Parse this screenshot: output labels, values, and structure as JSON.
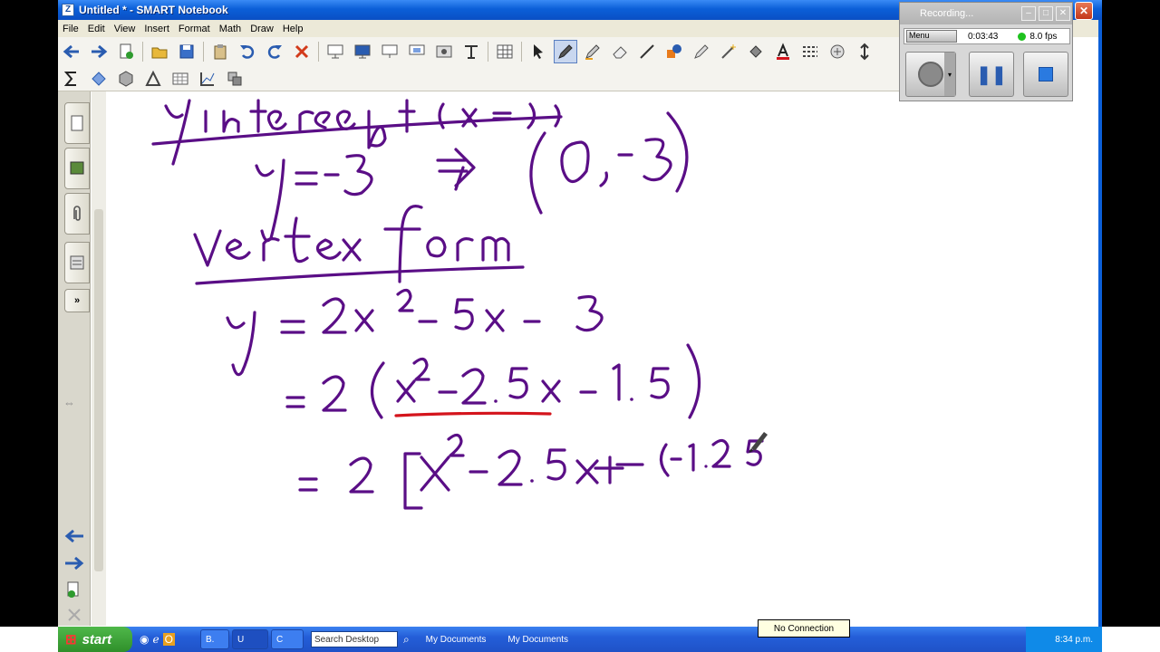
{
  "window": {
    "title": "Untitled * - SMART Notebook"
  },
  "menu": [
    "File",
    "Edit",
    "View",
    "Insert",
    "Format",
    "Math",
    "Draw",
    "Help"
  ],
  "toolbar1": [
    "back-arrow-icon",
    "forward-arrow-icon",
    "add-page-icon",
    "open-folder-icon",
    "save-icon",
    "paste-icon",
    "undo-icon",
    "redo-icon",
    "delete-icon",
    "screen-shade-icon",
    "full-screen-icon",
    "dual-display-icon",
    "capture-icon",
    "document-camera-icon",
    "table-icon",
    "select-icon",
    "pen-icon",
    "creative-pen-icon",
    "eraser-icon",
    "line-icon",
    "shape-icon",
    "magic-pen-icon",
    "fill-icon",
    "text-icon",
    "properties-icon",
    "move-toolbar-icon"
  ],
  "toolbar2": [
    "sigma-icon",
    "shape-recognition-icon",
    "3d-icon",
    "geometry-icon",
    "measure-icon",
    "graph-icon",
    "tools-icon"
  ],
  "recorder": {
    "title": "Recording...",
    "menu_label": "Menu",
    "elapsed": "0:03:43",
    "fps": "8.0 fps",
    "colors": {
      "ink": "#5a0e86",
      "underline": "#d4141c",
      "fps_dot": "#1ec21e"
    }
  },
  "taskbar": {
    "start_label": "start",
    "tasks": [
      {
        "label": "B."
      },
      {
        "label": "U"
      },
      {
        "label": "C"
      }
    ],
    "search_placeholder": "Search Desktop",
    "folders": [
      "My Documents",
      "My Documents"
    ],
    "tooltip": "No Connection",
    "clock": "8:34 p.m."
  }
}
